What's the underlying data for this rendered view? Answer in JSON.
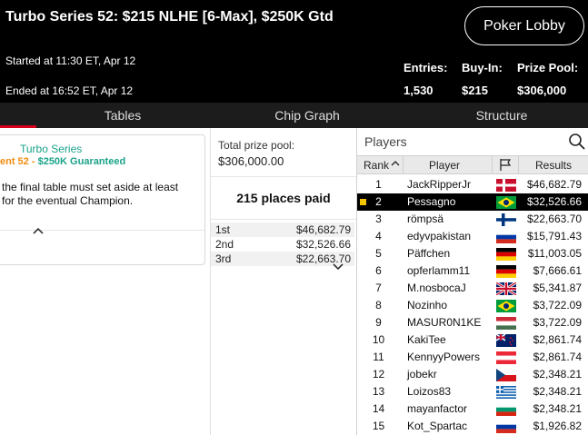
{
  "header": {
    "title": "Turbo Series 52: $215 NLHE [6-Max], $250K Gtd",
    "lobby_button": "Poker Lobby",
    "started": "Started at 11:30 ET, Apr 12",
    "ended": "Ended at 16:52 ET, Apr 12",
    "stats": [
      {
        "label": "Entries:",
        "value": "1,530"
      },
      {
        "label": "Buy-In:",
        "value": "$215"
      },
      {
        "label": "Prize Pool:",
        "value": "$306,000"
      }
    ]
  },
  "tabs": [
    "Tables",
    "Chip Graph",
    "Structure"
  ],
  "info": {
    "series_name": "Turbo Series",
    "sub_event": "ent 52 - ",
    "sub_guarantee": "$250K Guaranteed",
    "desc_line1": "the final table must set aside at least",
    "desc_line2": "for the eventual Champion."
  },
  "prizes": {
    "total_label": "Total prize pool:",
    "total_value": "$306,000.00",
    "places_paid": "215 places paid",
    "payouts": [
      {
        "place": "1st",
        "amount": "$46,682.79"
      },
      {
        "place": "2nd",
        "amount": "$32,526.66"
      },
      {
        "place": "3rd",
        "amount": "$22,663.70"
      }
    ]
  },
  "players": {
    "title": "Players",
    "columns": {
      "rank": "Rank",
      "player": "Player",
      "results": "Results"
    },
    "rows": [
      {
        "rank": "1",
        "name": "JackRipperJr",
        "flag": "denmark-flag",
        "result": "$46,682.79"
      },
      {
        "rank": "2",
        "name": "Pessagno",
        "flag": "brazil-flag",
        "result": "$32,526.66",
        "selected": true
      },
      {
        "rank": "3",
        "name": "römpsä",
        "flag": "finland-flag",
        "result": "$22,663.70"
      },
      {
        "rank": "4",
        "name": "edyvpakistan",
        "flag": "russia-flag",
        "result": "$15,791.43"
      },
      {
        "rank": "5",
        "name": "Päffchen",
        "flag": "germany-flag",
        "result": "$11,003.05"
      },
      {
        "rank": "6",
        "name": "opferlamm11",
        "flag": "germany-flag",
        "result": "$7,666.61"
      },
      {
        "rank": "7",
        "name": "M.nosbocaJ",
        "flag": "uk-flag",
        "result": "$5,341.87"
      },
      {
        "rank": "8",
        "name": "Nozinho",
        "flag": "brazil-flag",
        "result": "$3,722.09"
      },
      {
        "rank": "9",
        "name": "MASUR0N1KE",
        "flag": "hungary-flag",
        "result": "$3,722.09"
      },
      {
        "rank": "10",
        "name": "KakiTee",
        "flag": "new-zealand-flag",
        "result": "$2,861.74"
      },
      {
        "rank": "11",
        "name": "KennyyPowers",
        "flag": "austria-flag",
        "result": "$2,861.74"
      },
      {
        "rank": "12",
        "name": "jobekr",
        "flag": "czech-flag",
        "result": "$2,348.21"
      },
      {
        "rank": "13",
        "name": "Loizos83",
        "flag": "greece-flag",
        "result": "$2,348.21"
      },
      {
        "rank": "14",
        "name": "mayanfactor",
        "flag": "bulgaria-flag",
        "result": "$2,348.21"
      },
      {
        "rank": "15",
        "name": "Kot_Spartac",
        "flag": "russia-flag",
        "result": "$1,926.82"
      }
    ]
  }
}
